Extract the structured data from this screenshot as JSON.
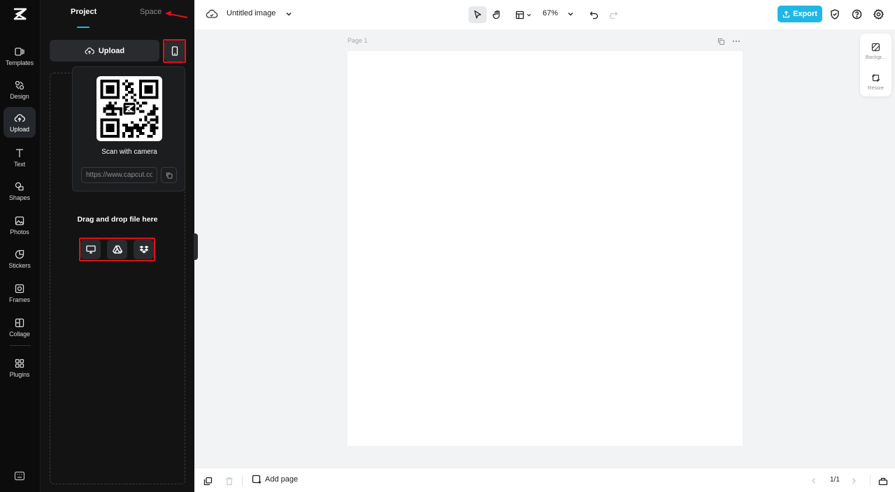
{
  "rail": {
    "items": [
      {
        "label": "Templates",
        "icon": "templates-icon"
      },
      {
        "label": "Design",
        "icon": "design-icon"
      },
      {
        "label": "Upload",
        "icon": "upload-cloud-icon",
        "active": true
      },
      {
        "label": "Text",
        "icon": "text-icon"
      },
      {
        "label": "Shapes",
        "icon": "shapes-icon"
      },
      {
        "label": "Photos",
        "icon": "photos-icon"
      },
      {
        "label": "Stickers",
        "icon": "stickers-icon"
      },
      {
        "label": "Frames",
        "icon": "frames-icon"
      },
      {
        "label": "Collage",
        "icon": "collage-icon"
      },
      {
        "label": "Plugins",
        "icon": "plugins-icon"
      }
    ]
  },
  "panel": {
    "tabs": {
      "project": "Project",
      "space": "Space"
    },
    "upload_label": "Upload",
    "qr_caption": "Scan with camera",
    "qr_url": "https://www.capcut.com",
    "drop_text": "Drag and drop file here",
    "sources": [
      "computer-icon",
      "google-drive-icon",
      "dropbox-icon"
    ]
  },
  "topbar": {
    "title": "Untitled image",
    "zoom": "67%",
    "export_label": "Export"
  },
  "canvas": {
    "page_label": "Page 1"
  },
  "side_tools": {
    "background": "Backgr...",
    "resize": "Resize"
  },
  "bottombar": {
    "add_page": "Add page",
    "page_count": "1/1"
  },
  "colors": {
    "accent": "#1fb8e6",
    "highlight": "#e0101a",
    "panel_bg": "#131314",
    "rail_bg": "#0c0c0d"
  }
}
